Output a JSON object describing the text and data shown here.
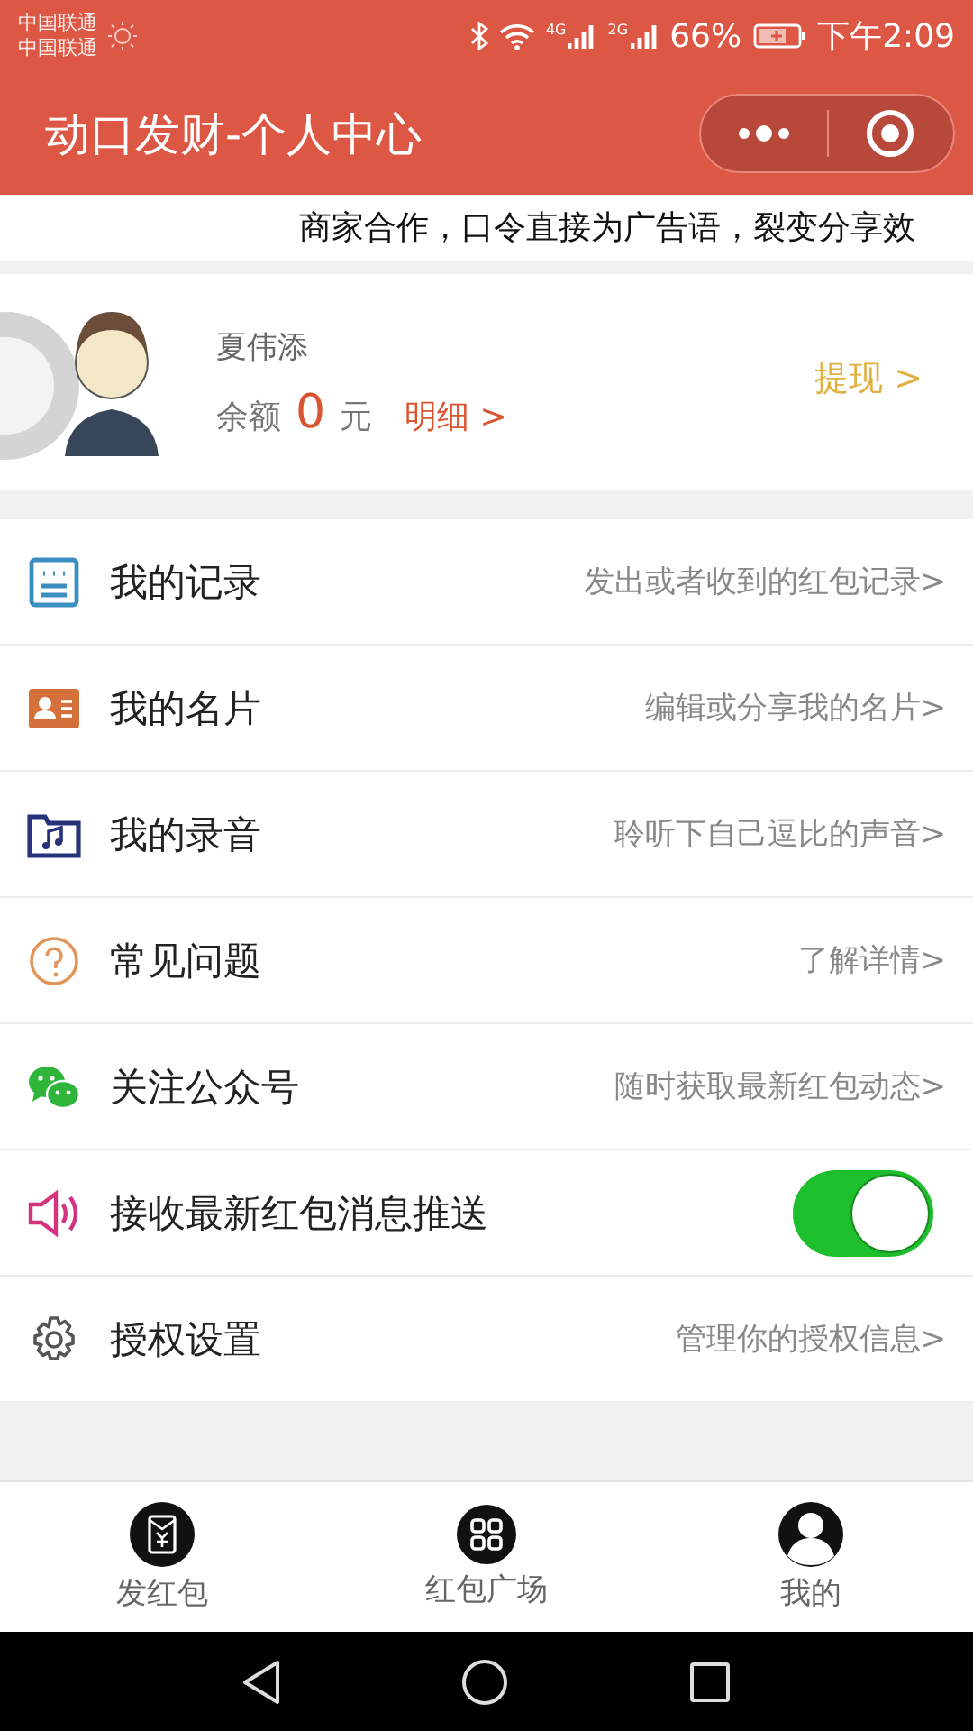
{
  "status_bar": {
    "carriers": [
      "中国联通",
      "中国联通"
    ],
    "network_1": "4G",
    "network_2": "2G",
    "battery": "66%",
    "time": "下午2:09"
  },
  "header": {
    "title": "动口发财-个人中心"
  },
  "marquee": {
    "text": "商家合作，口令直接为广告语，裂变分享效"
  },
  "profile": {
    "name": "夏伟添",
    "balance_label": "余额",
    "balance": "0",
    "currency": "元",
    "details_link": "明细 >",
    "withdraw_link": "提现 >"
  },
  "menu": [
    {
      "kind": "link",
      "label": "我的记录",
      "hint": "发出或者收到的红包记录>"
    },
    {
      "kind": "link",
      "label": "我的名片",
      "hint": "编辑或分享我的名片>"
    },
    {
      "kind": "link",
      "label": "我的录音",
      "hint": "聆听下自己逗比的声音>"
    },
    {
      "kind": "link",
      "label": "常见问题",
      "hint": "了解详情>"
    },
    {
      "kind": "link",
      "label": "关注公众号",
      "hint": "随时获取最新红包动态>"
    },
    {
      "kind": "toggle",
      "label": "接收最新红包消息推送",
      "on": true
    },
    {
      "kind": "link",
      "label": "授权设置",
      "hint": "管理你的授权信息>"
    }
  ],
  "tab_bar": [
    {
      "label": "发红包"
    },
    {
      "label": "红包广场"
    },
    {
      "label": "我的"
    }
  ]
}
